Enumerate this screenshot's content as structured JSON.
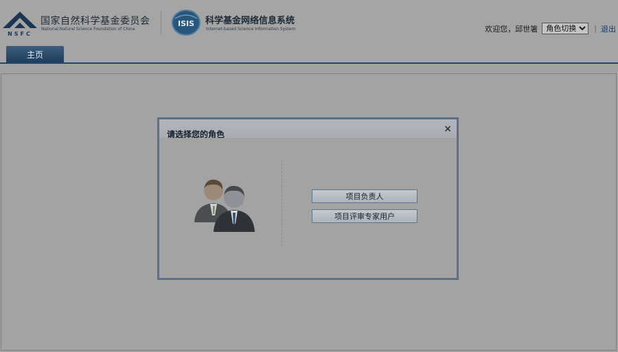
{
  "header": {
    "org_name_cn": "国家自然科学基金委员会",
    "org_name_en": "National Natural Science Foundation of China",
    "logo_text": "NSFC",
    "isis_logo_text": "ISIS",
    "system_name_cn": "科学基金网络信息系统",
    "system_name_en": "Internet-based Science Information System",
    "welcome_text": "欢迎您，邱世箸",
    "role_select": {
      "selected": "角色切换"
    },
    "separator": "|",
    "logout_label": "退出"
  },
  "tabs": [
    {
      "label": "主页",
      "active": true
    }
  ],
  "dialog": {
    "title": "请选择您的角色",
    "close_symbol": "×",
    "illustration_icon": "users-icon",
    "role_buttons": [
      {
        "label": "项目负责人"
      },
      {
        "label": "项目评审专家用户"
      }
    ]
  },
  "colors": {
    "dimmed_background": "#a3a3a3",
    "dialog_border": "#5a7088",
    "tab_active": "#24466a",
    "logout_link": "#0b3d74"
  }
}
